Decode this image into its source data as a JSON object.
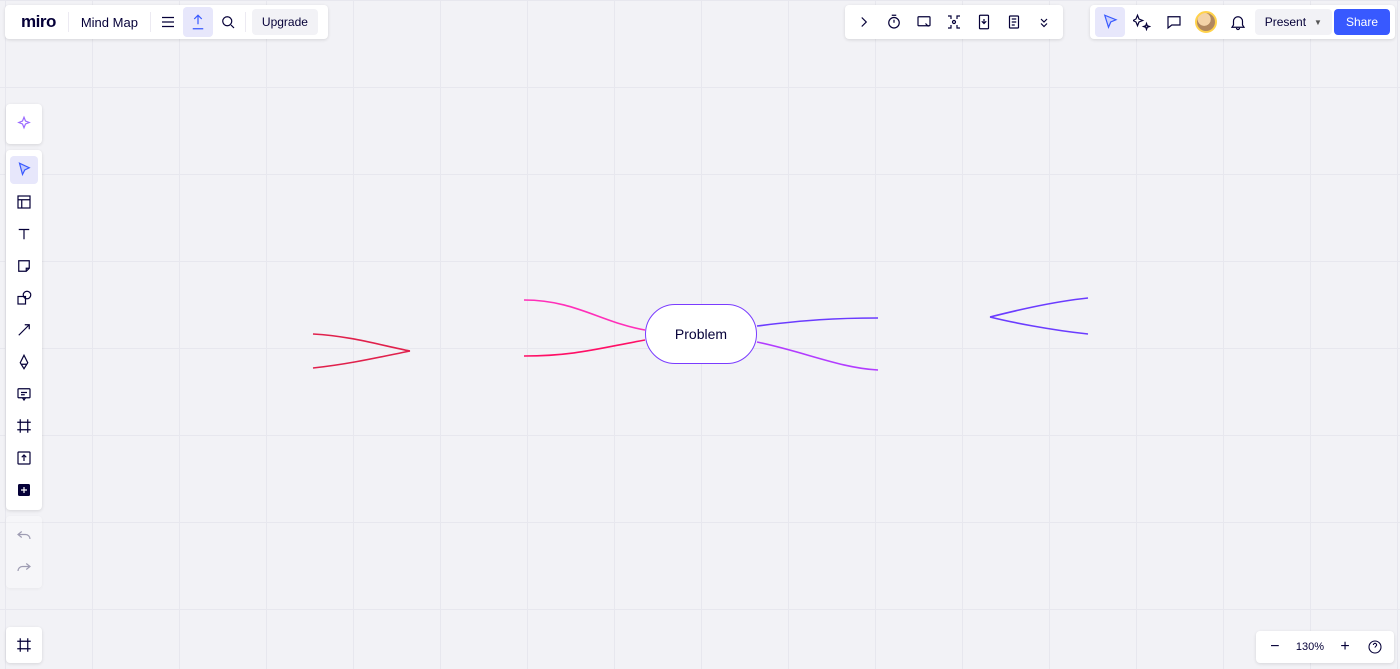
{
  "app": {
    "logo": "miro",
    "board_title": "Mind Map"
  },
  "topbar_left": {
    "upgrade": "Upgrade"
  },
  "topbar_right": {
    "present": "Present",
    "share": "Share"
  },
  "zoom": {
    "level": "130%"
  },
  "mindmap": {
    "central_node": "Problem",
    "node_color": "#7a3cff",
    "branches": {
      "left_upper_color": "#ff2fb9",
      "left_lower_color": "#ff0f66",
      "right_upper_color": "#6b3cff",
      "right_lower_color": "#b23cff",
      "far_left_color": "#e0214c",
      "far_right_color": "#6b3cff"
    }
  }
}
